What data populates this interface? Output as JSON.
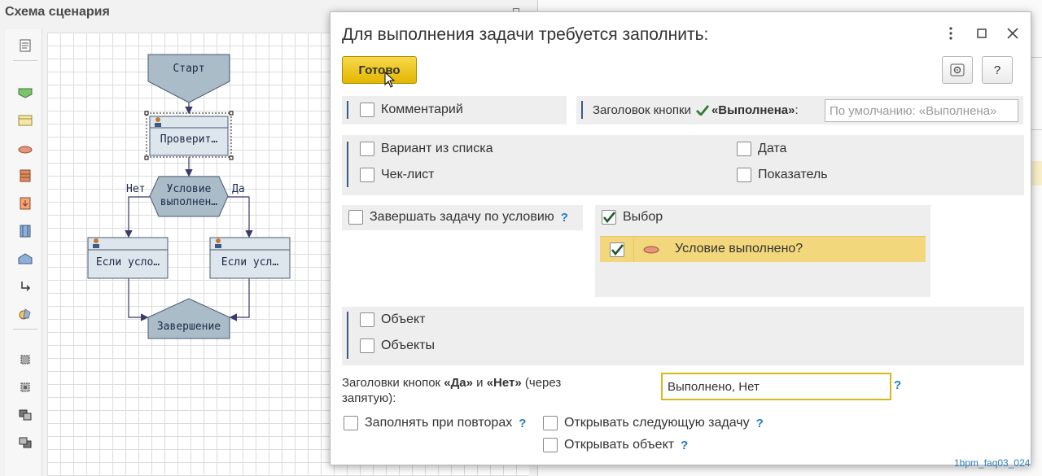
{
  "scheme": {
    "title": "Схема сценария",
    "nodes": {
      "start": "Старт",
      "check": "Проверит…",
      "condition_line1": "Условие",
      "condition_line2": "выполнен…",
      "left_branch": "Если усло…",
      "right_branch": "Если усл…",
      "finish": "Завершение"
    },
    "edges": {
      "no": "Нет",
      "yes": "Да"
    }
  },
  "dialog": {
    "title": "Для выполнения задачи требуется заполнить:",
    "done_label": "Готово",
    "help_label": "?",
    "comment_label": "Комментарий",
    "button_caption_label_prefix": "Заголовок кнопки",
    "button_caption_label_bold": "«Выполнена»",
    "button_caption_label_suffix": ":",
    "button_caption_placeholder": "По умолчанию: «Выполнена»",
    "option_list_label": "Вариант из списка",
    "checklist_label": "Чек-лист",
    "date_label": "Дата",
    "indicator_label": "Показатель",
    "finish_by_condition_label": "Завершать задачу по условию",
    "choice_label": "Выбор",
    "choice_item_label": "Условие выполнено?",
    "object_label": "Объект",
    "objects_label": "Объекты",
    "yes_no_caption": {
      "prefix": "Заголовки кнопок ",
      "yes": "«Да»",
      "and": " и ",
      "no": "«Нет»",
      "suffix": " (через",
      "line2": "запятую):"
    },
    "yes_no_value": "Выполнено, Нет",
    "fill_on_repeat_label": "Заполнять при повторах",
    "open_next_task_label": "Открывать следующую задачу",
    "open_object_label": "Открывать объект",
    "help_mark": "?"
  },
  "checkbox_states": {
    "comment": false,
    "option_list": false,
    "checklist": false,
    "date": false,
    "indicator": false,
    "finish_by_condition": false,
    "choice": true,
    "choice_item": true,
    "object": false,
    "objects": false,
    "fill_on_repeat": false,
    "open_next_task": false,
    "open_object": false
  },
  "footnote": "1bpm_faq03_024",
  "colors": {
    "accent_bar": "#3d5a80",
    "done_button": "#e8be0c",
    "help": "#1d7bc4",
    "selected_row": "#f2d77c",
    "check_mark": "#2e7d32"
  }
}
